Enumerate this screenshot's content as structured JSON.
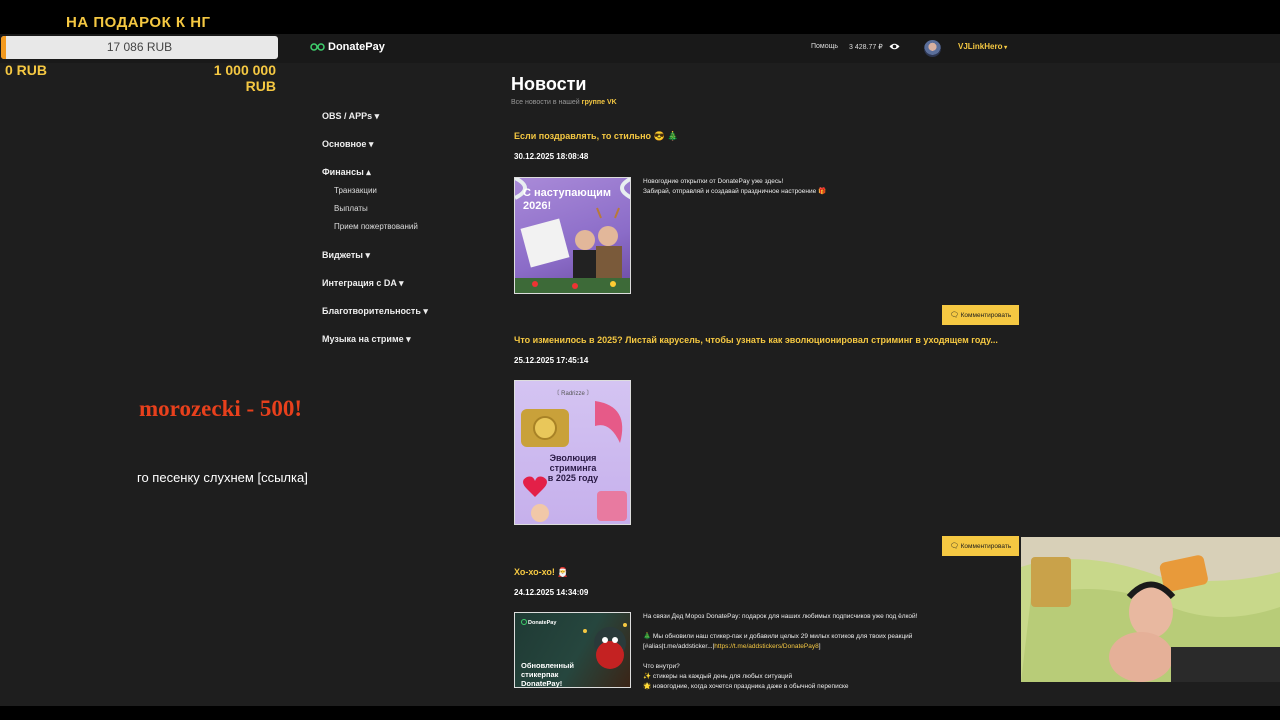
{
  "goal": {
    "title": "НА ПОДАРОК К НГ",
    "amount": "17 086 RUB",
    "min": "0 RUB",
    "max": "1 000 000 RUB",
    "progress": 0.017,
    "fill_color": "#f39a1f"
  },
  "header": {
    "logo": "DonatePay",
    "help": "Помощь",
    "balance": "3 428.77 ₽",
    "username": "VJLinkHero",
    "accent": "#f5c842"
  },
  "sidebar": {
    "groups": [
      {
        "label": "OBS / APPs ▾"
      },
      {
        "label": "Основное ▾"
      },
      {
        "label": "Финансы ▴"
      },
      {
        "label": "Виджеты ▾"
      },
      {
        "label": "Интеграция с DA ▾"
      },
      {
        "label": "Благотворительность ▾"
      },
      {
        "label": "Музыка на стриме ▾"
      }
    ],
    "finance_items": [
      "Транзакции",
      "Выплаты",
      "Прием пожертвований"
    ]
  },
  "main": {
    "title": "Новости",
    "subtitle": "Все новости в нашей",
    "subtitle_link": "группе VK",
    "comment_label": "Комментировать",
    "posts": [
      {
        "title": "Если поздравлять, то стильно 😎 🎄",
        "date": "30.12.2025 18:08:48",
        "lines": [
          "Новогодние открытки от DonatePay уже здесь!",
          "Забирай, отправляй и создавай праздничное настроение 🎁"
        ],
        "image_text": "С наступающим 2026!",
        "image_logo": "DonatePay"
      },
      {
        "title": "Что изменилось в 2025? Листай карусель, чтобы узнать как эволюционировал стриминг в уходящем году...",
        "date": "25.12.2025 17:45:14",
        "image_text": "Эволюция стриминга в 2025 году",
        "image_logo": "Radrizze"
      },
      {
        "title": "Хо-хо-хо! 🎅",
        "date": "24.12.2025 14:34:09",
        "lines": [
          "На связи Дед Мороз DonatePay: подарок для наших любимых подписчиков уже под ёлкой!",
          "",
          "🎄 Мы обновили наш стикер-пак и добавили целых 29 милых котиков для твоих реакций",
          "",
          "",
          "Что внутри?",
          "✨ стикеры на каждый день для любых ситуаций",
          "🌟 новогодние, когда хочется праздника даже в обычной переписке"
        ],
        "link_prefix": "[#alias|t.me/addsticker...|",
        "link_text": "https://t.me/addstickers/DonatePay8",
        "link_suffix": "]",
        "image_text": "Обновленный стикерпак DonatePay!",
        "image_logo": "DonatePay"
      }
    ]
  },
  "donation": {
    "donor_line": "morozecki - 500!",
    "message": "го песенку слухнем [ссылка]",
    "color": "#e8401c"
  }
}
